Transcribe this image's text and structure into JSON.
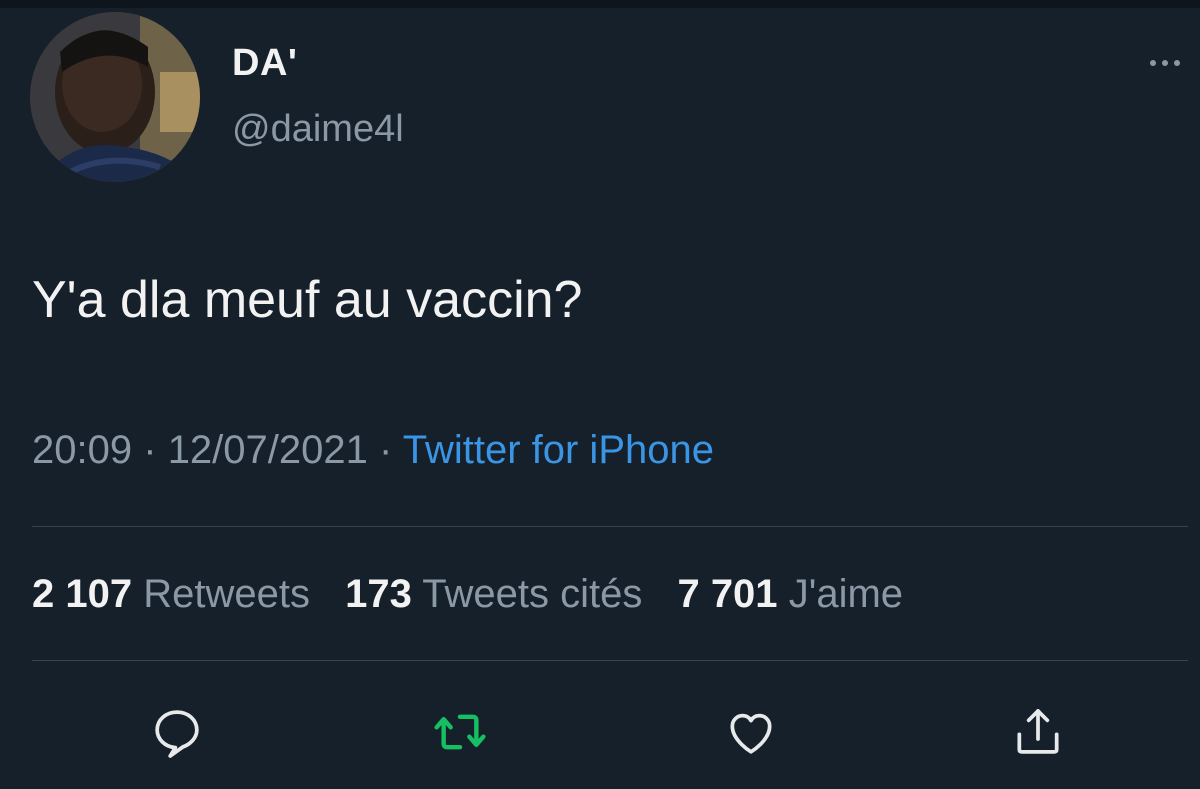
{
  "tweet": {
    "author_name": "DA'",
    "author_handle": "@daime4l",
    "text": "Y'a dla meuf au vaccin?",
    "time": "20:09",
    "date": "12/07/2021",
    "separator": "·",
    "source": "Twitter for iPhone"
  },
  "stats": {
    "retweets_count": "2 107",
    "retweets_label": "Retweets",
    "quotes_count": "173",
    "quotes_label": "Tweets cités",
    "likes_count": "7 701",
    "likes_label": "J'aime"
  },
  "actions": {
    "reply_icon": "reply-bubble-icon",
    "retweet_icon": "retweet-arrows-icon",
    "like_icon": "heart-icon",
    "share_icon": "share-upload-icon"
  },
  "colors": {
    "background": "#15202b",
    "link": "#3b95e5",
    "retweet_active": "#17bf63",
    "muted": "#8b98a5"
  }
}
